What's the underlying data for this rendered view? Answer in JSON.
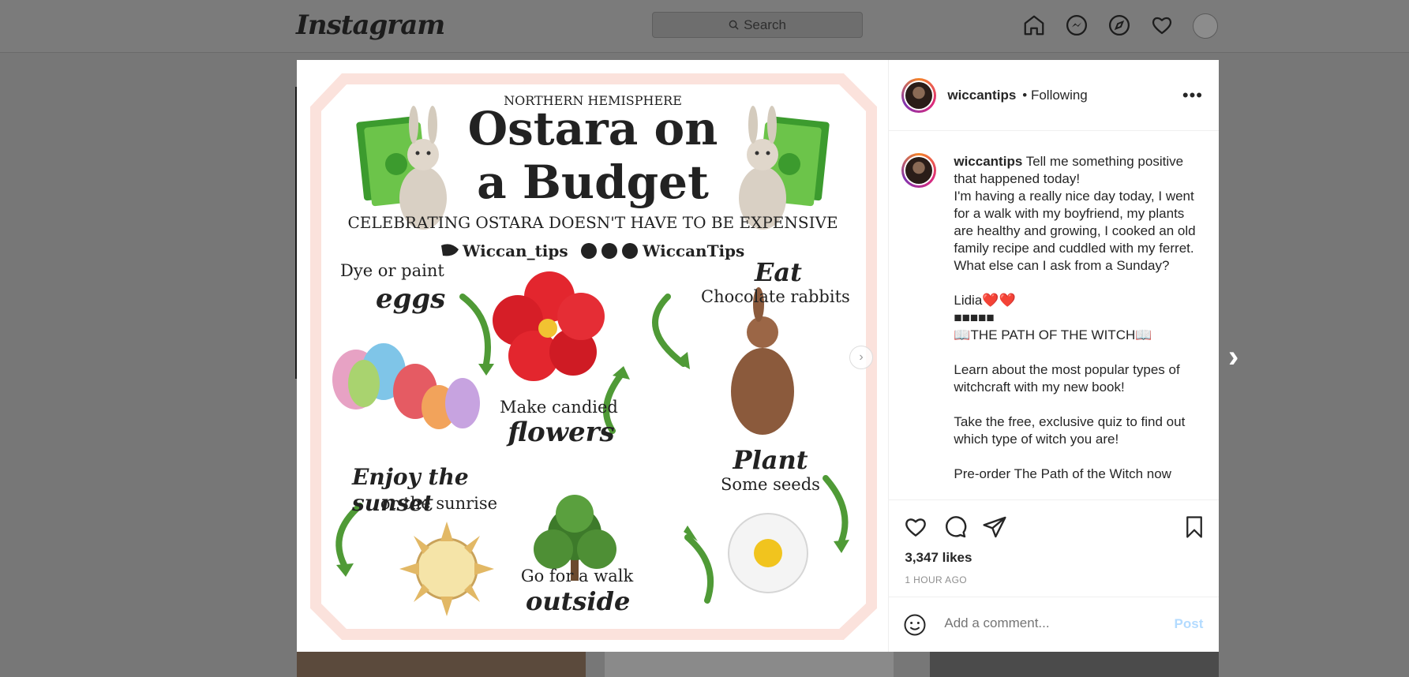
{
  "topbar": {
    "logo": "Instagram",
    "search_placeholder": "Search"
  },
  "icons": {
    "home": "home-icon",
    "messenger": "messenger-icon",
    "explore": "compass-icon",
    "activity": "heart-icon",
    "profile": "avatar"
  },
  "post": {
    "username": "wiccantips",
    "following": "• Following",
    "caption_user": "wiccantips",
    "caption_lines": [
      " Tell me something positive that happened today!",
      "I'm having a really nice day today, I went for a walk with my boyfriend, my plants are healthy and growing, I cooked an old family recipe and cuddled with my ferret. What else can I ask from a Sunday?",
      "",
      "Lidia❤️❤️",
      "■■■■■",
      "📖THE PATH OF THE WITCH📖",
      "",
      "Learn about the most popular types of witchcraft with my new book!",
      "",
      "Take the free, exclusive quiz to find out which type of witch you are!",
      "",
      "Pre-order The Path of the Witch now"
    ],
    "likes": "3,347 likes",
    "time": "1 HOUR AGO",
    "comment_placeholder": "Add a comment...",
    "post_label": "Post"
  },
  "infographic": {
    "hemisphere": "NORTHERN HEMISPHERE",
    "title_line1": "Ostara on",
    "title_line2": "a Budget",
    "subtitle": "CELEBRATING OSTARA  DOESN'T HAVE TO BE EXPENSIVE",
    "twitter": "Wiccan_tips",
    "socials": "WiccanTips",
    "eggs_top": "Dye or paint",
    "eggs_script": "eggs",
    "eat_script": "Eat",
    "eat_text": "Chocolate rabbits",
    "flowers_text": "Make candied",
    "flowers_script": "flowers",
    "sunset_script": "Enjoy the sunset",
    "sunset_text": "or the sunrise",
    "plant_script": "Plant",
    "plant_text": "Some seeds",
    "walk_text": "Go for a walk",
    "walk_script": "outside"
  },
  "colors": {
    "accent": "#0095f6",
    "post_disabled": "#b3dbff",
    "frame": "#fbe2dc",
    "arrow_green": "#4f9a36"
  }
}
